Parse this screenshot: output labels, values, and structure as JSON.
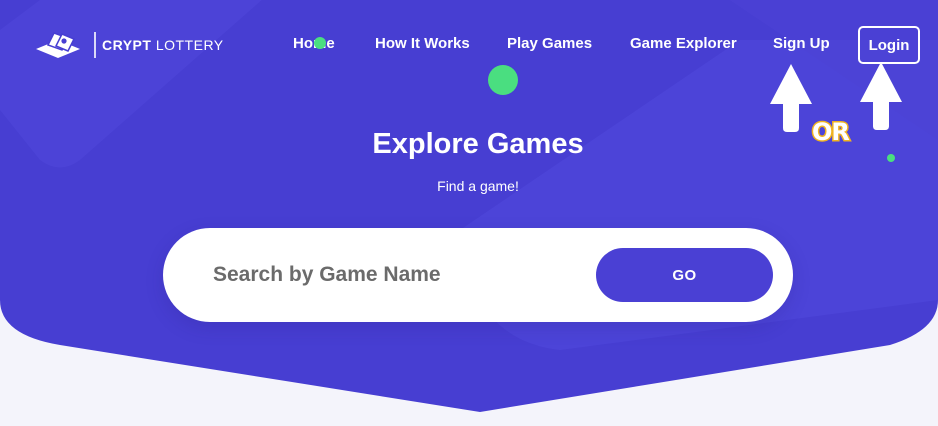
{
  "brand": {
    "name_bold": "CRYPT",
    "name_light": "LOTTERY",
    "icon": "lottery-ticket-logo-icon"
  },
  "nav": {
    "items": [
      {
        "label": "Home"
      },
      {
        "label": "How It Works"
      },
      {
        "label": "Play Games"
      },
      {
        "label": "Game Explorer"
      },
      {
        "label": "Sign Up"
      }
    ],
    "login_label": "Login"
  },
  "hero": {
    "title": "Explore Games",
    "subtitle": "Find a game!"
  },
  "search": {
    "placeholder": "Search by Game Name",
    "value": "",
    "button_label": "GO"
  },
  "annotation": {
    "or_label": "OR",
    "arrow_icon": "up-arrow-icon"
  },
  "colors": {
    "hero_primary": "#4a40d4",
    "hero_accent": "#5a50e0",
    "page_background": "#f4f4fb",
    "dot_green": "#4ade80",
    "or_outline": "#f0b320"
  }
}
